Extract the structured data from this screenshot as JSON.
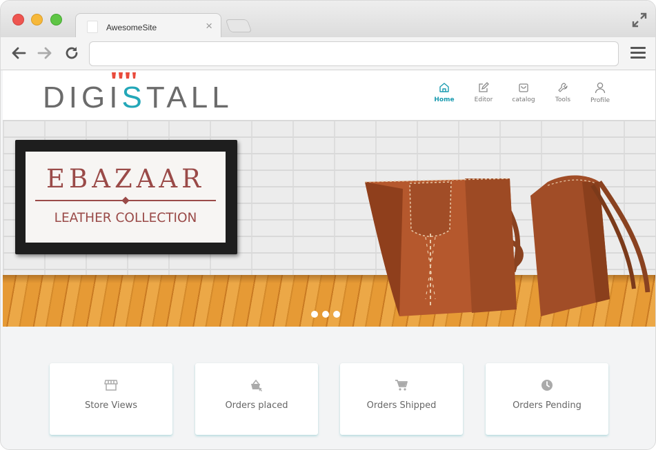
{
  "browser": {
    "tab_title": "AwesomeSite",
    "tab_close": "×",
    "url": ""
  },
  "site": {
    "logo_text_left": "DIGI",
    "logo_text_accent": "S",
    "logo_text_right": "TALL",
    "logo_accent_color": "#23a7b8",
    "nav": [
      {
        "label": "Home",
        "icon": "home-icon",
        "active": true
      },
      {
        "label": "Editor",
        "icon": "edit-icon",
        "active": false
      },
      {
        "label": "catalog",
        "icon": "bag-icon",
        "active": false
      },
      {
        "label": "Tools",
        "icon": "wrench-icon",
        "active": false
      },
      {
        "label": "Profile",
        "icon": "user-icon",
        "active": false
      }
    ]
  },
  "banner": {
    "title": "EBAZAAR",
    "subtitle": "LEATHER COLLECTION",
    "slides": 3
  },
  "cards": [
    {
      "label": "Store Views",
      "icon": "store-icon"
    },
    {
      "label": "Orders placed",
      "icon": "orders-placed-icon"
    },
    {
      "label": "Orders Shipped",
      "icon": "cart-icon"
    },
    {
      "label": "Orders Pending",
      "icon": "clock-icon"
    }
  ]
}
